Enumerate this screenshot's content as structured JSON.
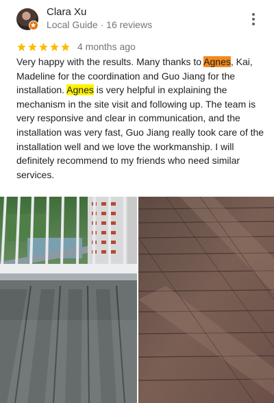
{
  "author": {
    "name": "Clara Xu",
    "subtitle": "Local Guide · 16 reviews",
    "avatar_icon": "profile-photo",
    "badge_icon": "local-guide-star-icon",
    "badge_color": "#e8710a"
  },
  "menu_icon": "more-vertical-icon",
  "review": {
    "stars": 5,
    "star_color": "#fbbc04",
    "time": "4 months ago",
    "text_parts": {
      "p1": "Very happy with the results. Many thanks to ",
      "h1": "Agnes",
      "p2": ", Kai, Madeline for the coordination and Guo Jiang for the installation. ",
      "h2": "Agnes",
      "p3": " is very helpful in explaining the mechanism in the site visit and following up. The team is very responsive and clear in communication, and the installation was very fast, Guo Jiang really took care of the installation well and we love the workmanship. I will definitely recommend to my friends who need similar services."
    },
    "highlight_colors": [
      "#f28b1c",
      "#fff200"
    ]
  },
  "photos": [
    {
      "icon": "balcony-decking-photo"
    },
    {
      "icon": "wood-decking-photo"
    }
  ]
}
